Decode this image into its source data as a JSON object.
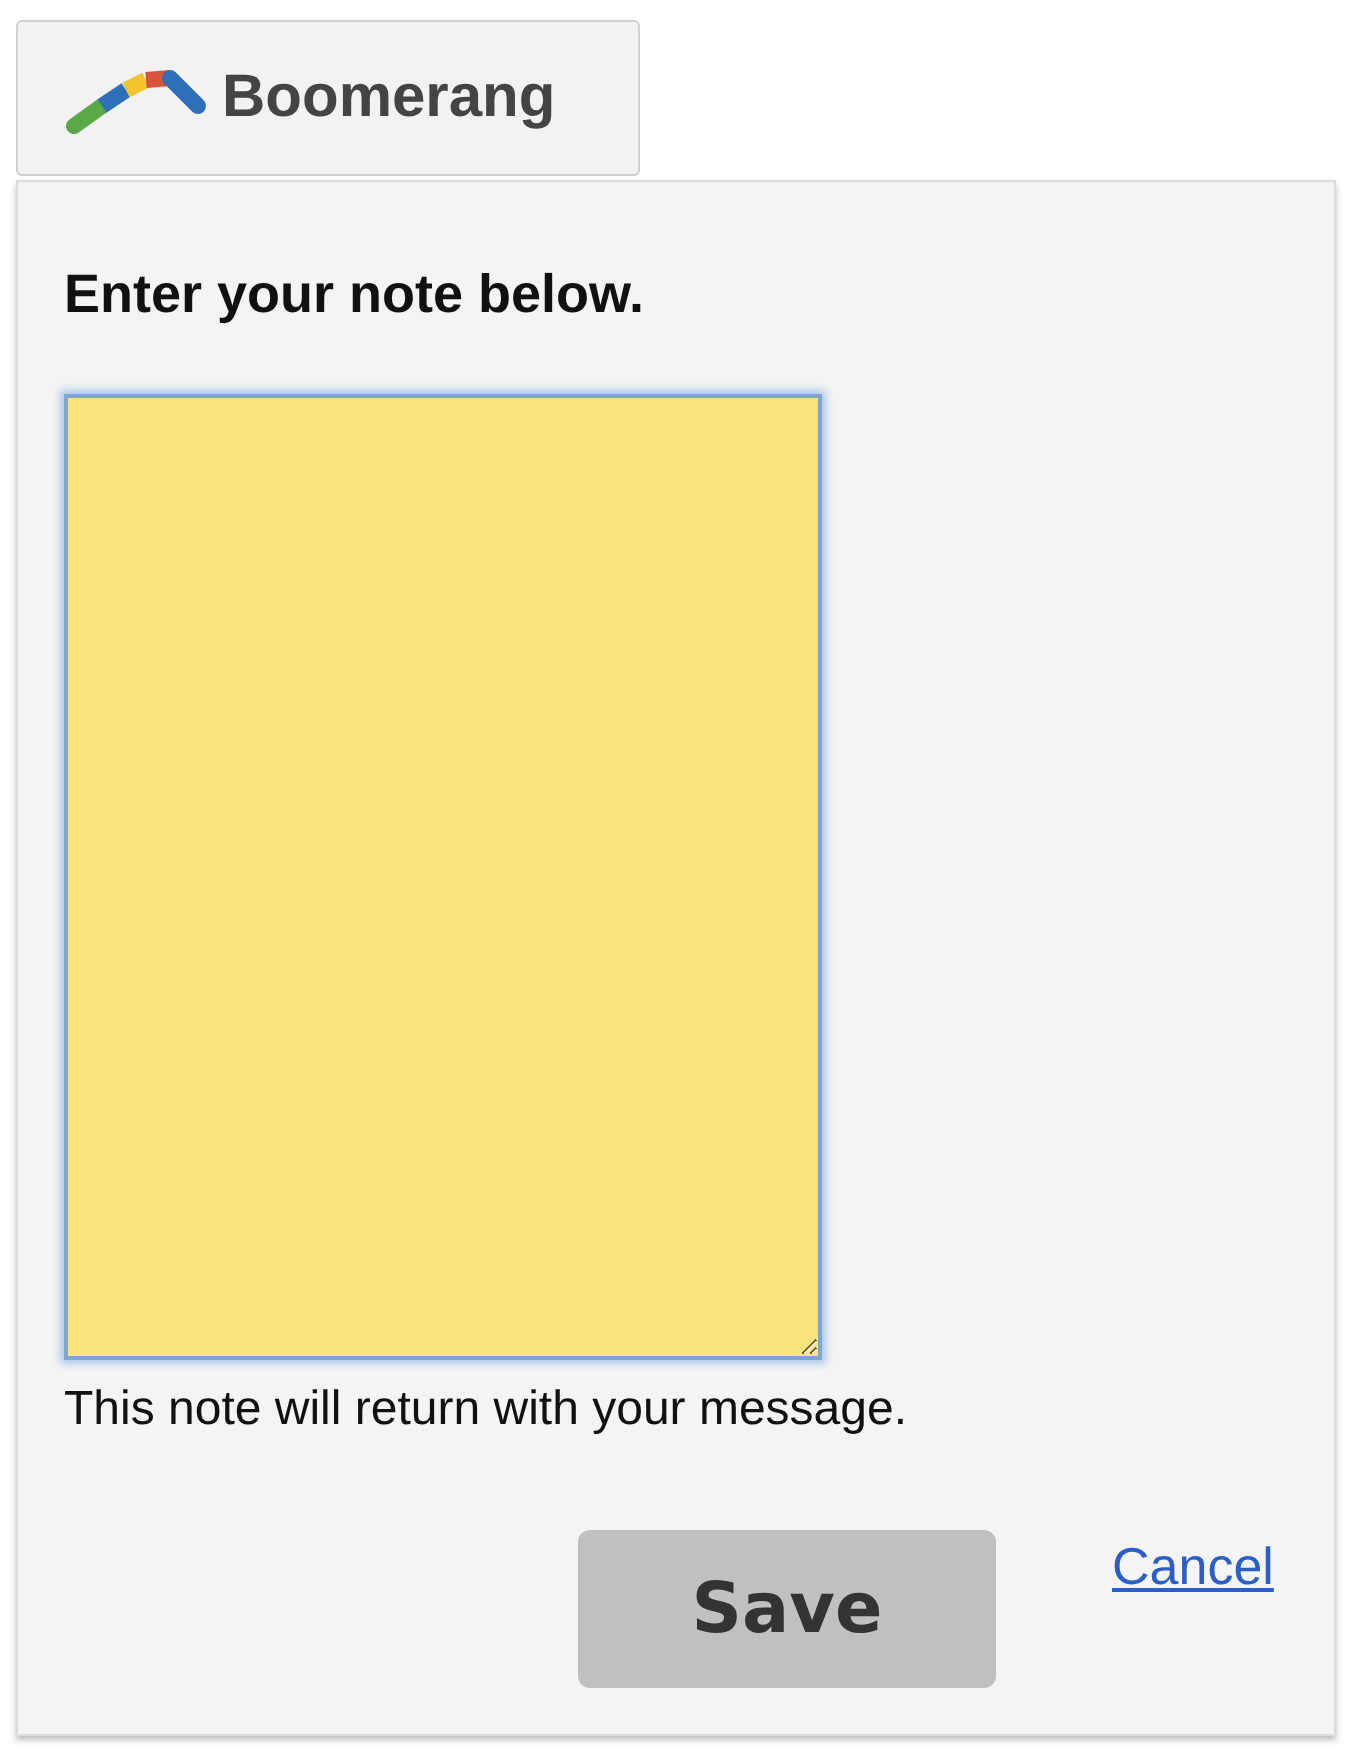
{
  "toolbar_button": {
    "label": "Boomerang"
  },
  "popup": {
    "heading": "Enter your note below.",
    "note_field": {
      "focused": true
    },
    "hint": "This note will return with your message.",
    "save_button": {
      "label": "Save",
      "disabled": true
    },
    "cancel_link": {
      "label": "Cancel"
    }
  }
}
